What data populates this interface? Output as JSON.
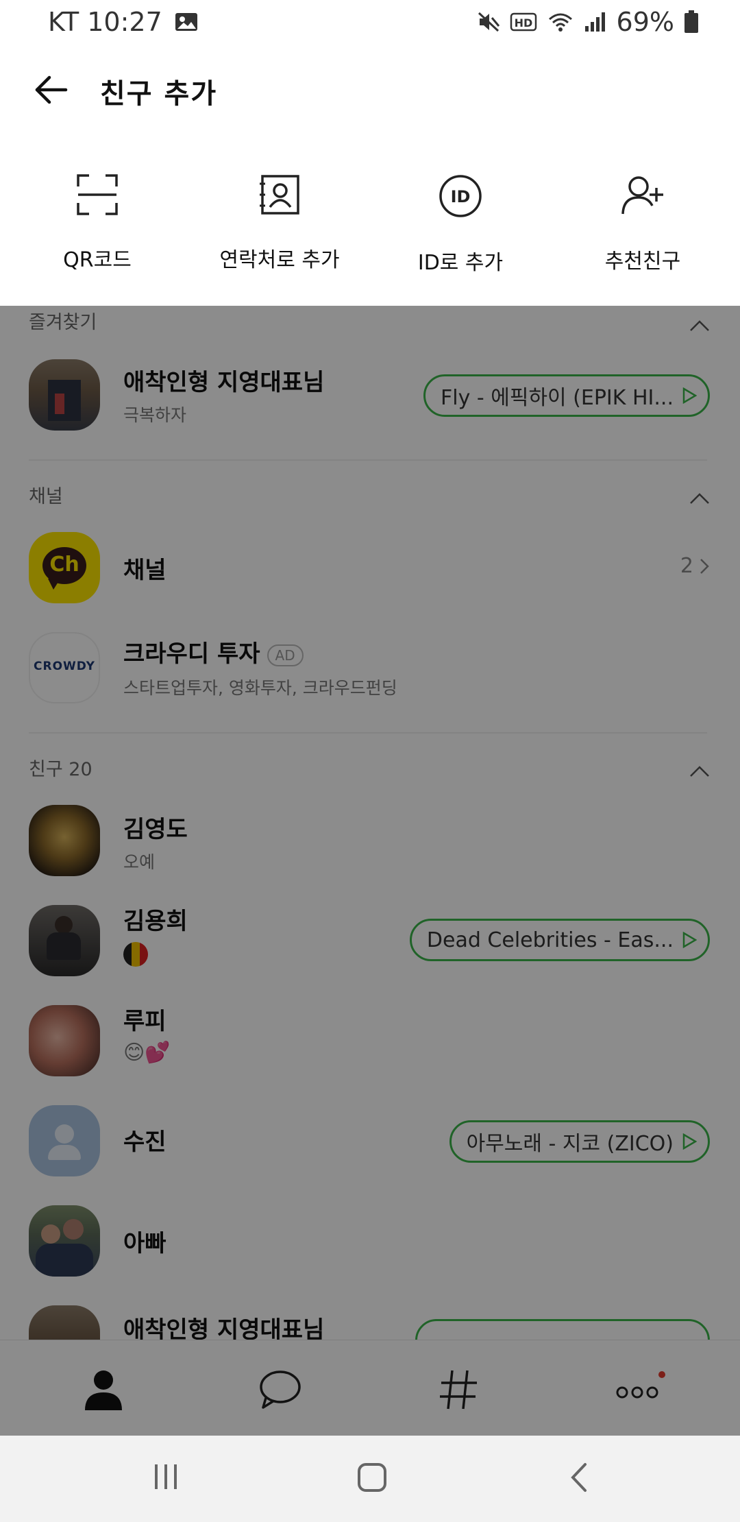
{
  "status_bar": {
    "carrier_time": "KT 10:27",
    "battery": "69%"
  },
  "header": {
    "title": "친구 추가"
  },
  "add_options": [
    {
      "label": "QR코드",
      "icon": "qr-scan-icon"
    },
    {
      "label": "연락처로 추가",
      "icon": "contact-book-icon"
    },
    {
      "label": "ID로 추가",
      "icon": "id-circle-icon"
    },
    {
      "label": "추천친구",
      "icon": "person-add-icon"
    }
  ],
  "favorites": {
    "header": "즐겨찾기",
    "items": [
      {
        "name": "애착인형 지영대표님",
        "status": "극복하자",
        "music": "Fly - 에픽하이 (EPIK HI..."
      }
    ]
  },
  "channels": {
    "header": "채널",
    "items": [
      {
        "name": "채널",
        "count": "2",
        "icon_text": "Ch"
      },
      {
        "name": "크라우디 투자",
        "badge": "AD",
        "desc": "스타트업투자, 영화투자, 크라우드펀딩",
        "logo_text": "CROWDY"
      }
    ]
  },
  "friends": {
    "header": "친구 20",
    "items": [
      {
        "name": "김영도",
        "status": "오예",
        "music": ""
      },
      {
        "name": "김용희",
        "status": "",
        "music": "Dead Celebrities - Eas..."
      },
      {
        "name": "루피",
        "status": "😊💕",
        "music": ""
      },
      {
        "name": "수진",
        "status": "",
        "music": "아무노래 - 지코 (ZICO)"
      },
      {
        "name": "아빠",
        "status": "",
        "music": ""
      },
      {
        "name": "애착인형 지영대표님",
        "status": "",
        "music": ""
      }
    ]
  },
  "bottom_nav": [
    "friends-tab",
    "chats-tab",
    "hashtag-tab",
    "more-tab"
  ],
  "colors": {
    "music_border": "#3bb54a",
    "channel_yellow": "#fee500",
    "dim_overlay": "rgba(0,0,0,0.45)"
  }
}
